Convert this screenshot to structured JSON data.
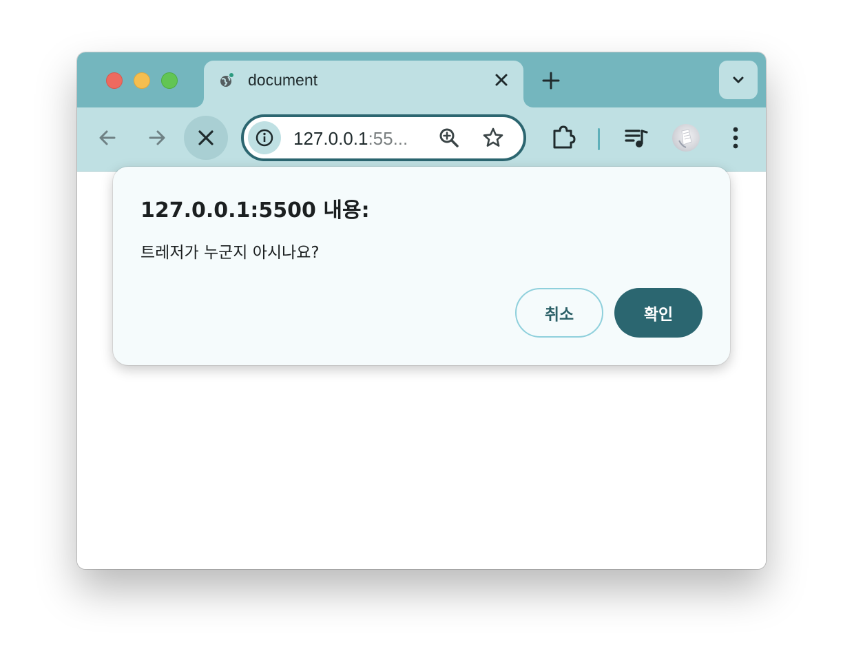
{
  "window": {
    "traffic_lights": [
      "close",
      "minimize",
      "maximize"
    ]
  },
  "tab": {
    "title": "document",
    "favicon": "globe-icon",
    "close_icon": "close-icon"
  },
  "tabstrip": {
    "new_tab_icon": "plus-icon",
    "tab_search_icon": "chevron-down-icon"
  },
  "toolbar": {
    "back_icon": "arrow-left-icon",
    "forward_icon": "arrow-right-icon",
    "stop_icon": "close-icon",
    "site_info_icon": "info-icon",
    "url_host": "127.0.0.1",
    "url_rest": ":55...",
    "zoom_icon": "zoom-in-icon",
    "bookmark_icon": "star-icon",
    "extensions_icon": "puzzle-icon",
    "media_icon": "playlist-music-icon",
    "menu_icon": "more-vertical-icon"
  },
  "dialog": {
    "title": "127.0.0.1:5500 내용:",
    "message": "트레저가 누군지 아시나요?",
    "cancel_label": "취소",
    "ok_label": "확인"
  },
  "colors": {
    "tabstrip_bg": "#74b6be",
    "toolbar_bg": "#bfe0e3",
    "accent": "#2b6670",
    "dialog_bg": "#f5fbfc"
  }
}
